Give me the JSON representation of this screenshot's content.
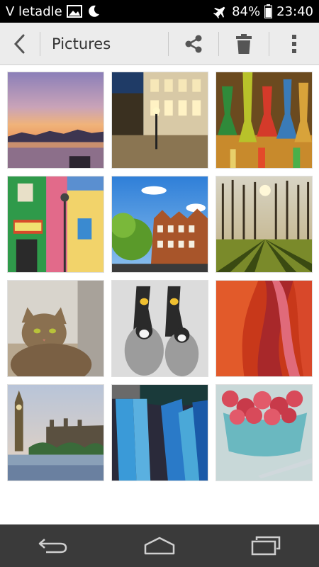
{
  "status_bar": {
    "carrier": "V letadle",
    "battery": "84%",
    "time": "23:40"
  },
  "action_bar": {
    "title": "Pictures"
  },
  "gallery": {
    "thumbnails": [
      {
        "subject": "lake-sunset"
      },
      {
        "subject": "town-square-night"
      },
      {
        "subject": "hookahs"
      },
      {
        "subject": "caminito-street"
      },
      {
        "subject": "amsterdam-houses"
      },
      {
        "subject": "forest-sunrise"
      },
      {
        "subject": "tabby-cat"
      },
      {
        "subject": "penguins"
      },
      {
        "subject": "red-canyon"
      },
      {
        "subject": "big-ben"
      },
      {
        "subject": "blue-scarves"
      },
      {
        "subject": "raspberries"
      }
    ]
  },
  "colors": {
    "status_bar": "#000000",
    "action_bar": "#ececec",
    "nav_bar": "#3a3a3a"
  }
}
